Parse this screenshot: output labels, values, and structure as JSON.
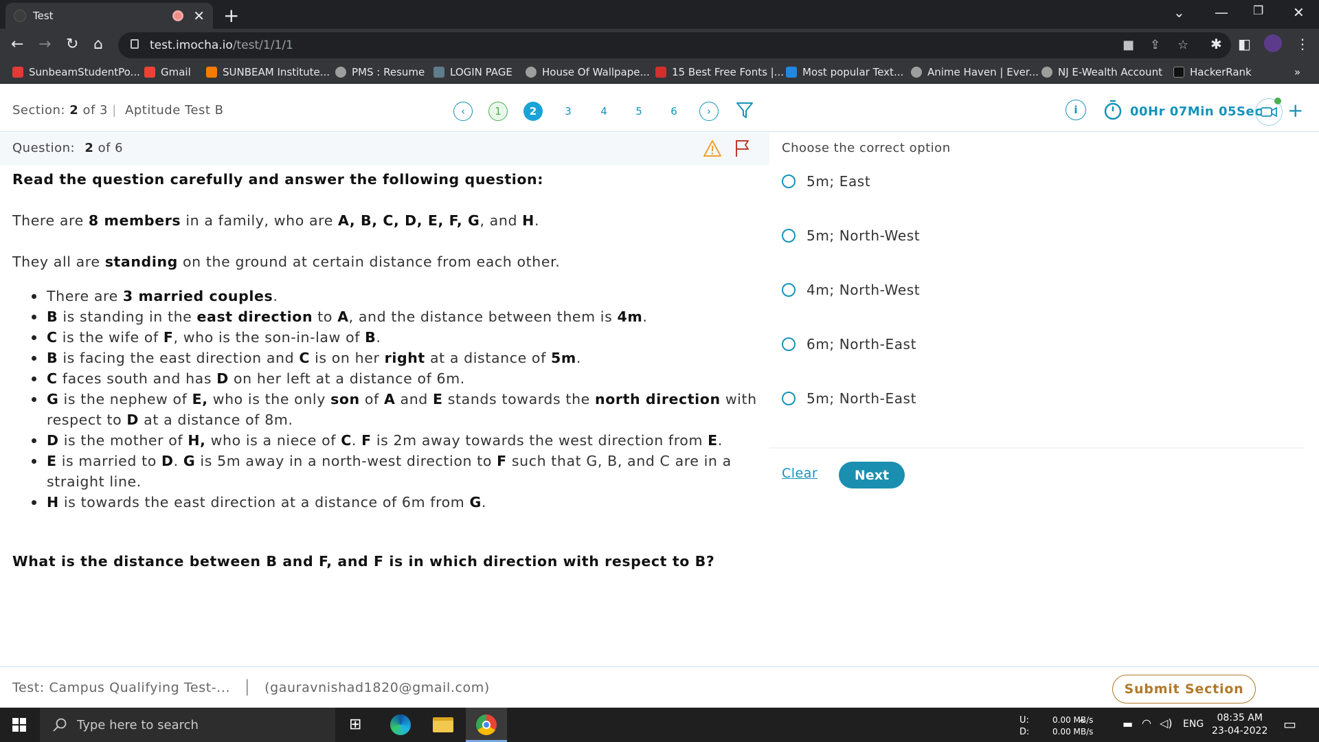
{
  "browser": {
    "tab_title": "Test",
    "url_host": "test.imocha.io",
    "url_path": "/test/1/1/1",
    "bookmarks": [
      {
        "label": "SunbeamStudentPo...",
        "color": "#e53935"
      },
      {
        "label": "Gmail",
        "color": "#ea4335"
      },
      {
        "label": "SUNBEAM Institute...",
        "color": "#f57c00"
      },
      {
        "label": "PMS : Resume",
        "color": "#9e9e9e"
      },
      {
        "label": "LOGIN PAGE",
        "color": "#607d8b"
      },
      {
        "label": "House Of Wallpape...",
        "color": "#9e9e9e"
      },
      {
        "label": "15 Best Free Fonts |...",
        "color": "#d32f2f"
      },
      {
        "label": "Most popular Text...",
        "color": "#1e88e5"
      },
      {
        "label": "Anime Haven | Ever...",
        "color": "#9e9e9e"
      },
      {
        "label": "NJ E-Wealth Account",
        "color": "#9e9e9e"
      },
      {
        "label": "HackerRank",
        "color": "#111"
      }
    ],
    "more": "»"
  },
  "section": {
    "label": "Section:",
    "current": "2",
    "of": "of 3",
    "divider": "|",
    "name": "Aptitude Test B",
    "questions": [
      "1",
      "2",
      "3",
      "4",
      "5",
      "6"
    ],
    "prev": "‹",
    "next": "›",
    "timer": "00Hr 07Min 05Sec",
    "info": "i"
  },
  "question": {
    "label": "Question:",
    "current": "2",
    "of": "of 6",
    "intro": "Read the question carefully and answer the following question:",
    "p1": [
      "There are ",
      "8 members",
      " in a family, who are ",
      "A, B, C, D, E, F, G",
      ", and ",
      "H",
      "."
    ],
    "p2": [
      "They all are ",
      "standing",
      " on the ground at certain distance from each other."
    ],
    "clues": [
      [
        "There are ",
        "3 married couples",
        "."
      ],
      [
        "B",
        " is standing in the ",
        "east direction",
        " to ",
        "A",
        ", and the distance between them is ",
        "4m",
        "."
      ],
      [
        "C",
        " is the wife of ",
        "F",
        ", who is the son-in-law of ",
        "B",
        "."
      ],
      [
        "B",
        " is facing the east direction and ",
        "C",
        " is on her ",
        "right",
        " at a distance of ",
        "5m",
        "."
      ],
      [
        "C",
        " faces south and has ",
        "D",
        " on her left at a distance of 6m.",
        ""
      ],
      [
        "G",
        " is the nephew of ",
        "E,",
        " who is the only ",
        "son",
        " of ",
        "A",
        " and ",
        "E",
        " stands towards the ",
        "north direction",
        " with respect to ",
        "D",
        " at a distance of 8m."
      ],
      [
        "D",
        " is the mother of ",
        "H,",
        " who is a niece of ",
        "C",
        ". ",
        "F",
        " is 2m away towards the west direction from ",
        "E",
        "."
      ],
      [
        "E",
        " is married to ",
        "D",
        ". ",
        "G",
        " is 5m away in a north-west direction to ",
        "F",
        " such that G, B, and C are in a straight line."
      ],
      [
        "H",
        " is towards the east direction at a distance of 6m from ",
        "G",
        "."
      ]
    ],
    "ask": "What is the distance between B and F, and F is in which direction with respect to B?"
  },
  "answers": {
    "label": "Choose the correct option",
    "options": [
      "5m; East",
      "5m; North-West",
      "4m; North-West",
      "6m; North-East",
      "5m; North-East"
    ],
    "clear": "Clear",
    "next": "Next"
  },
  "footer": {
    "test_name": "Test: Campus Qualifying Test-...",
    "sep": "|",
    "email": "(gauravnishad1820@gmail.com)",
    "submit": "Submit Section"
  },
  "taskbar": {
    "search_placeholder": "Type here to search",
    "net_up_label": "U:",
    "net_down_label": "D:",
    "net_up": "0.00 MB/s",
    "net_down": "0.00 MB/s",
    "lang": "ENG",
    "time": "08:35 AM",
    "date": "23-04-2022"
  },
  "colors": {
    "accent": "#1593b9",
    "answered": "#4caf50",
    "current_q": "#1aa3d6",
    "warning": "#f0a030",
    "flag": "#c0392b",
    "submit": "#b07a2a"
  }
}
